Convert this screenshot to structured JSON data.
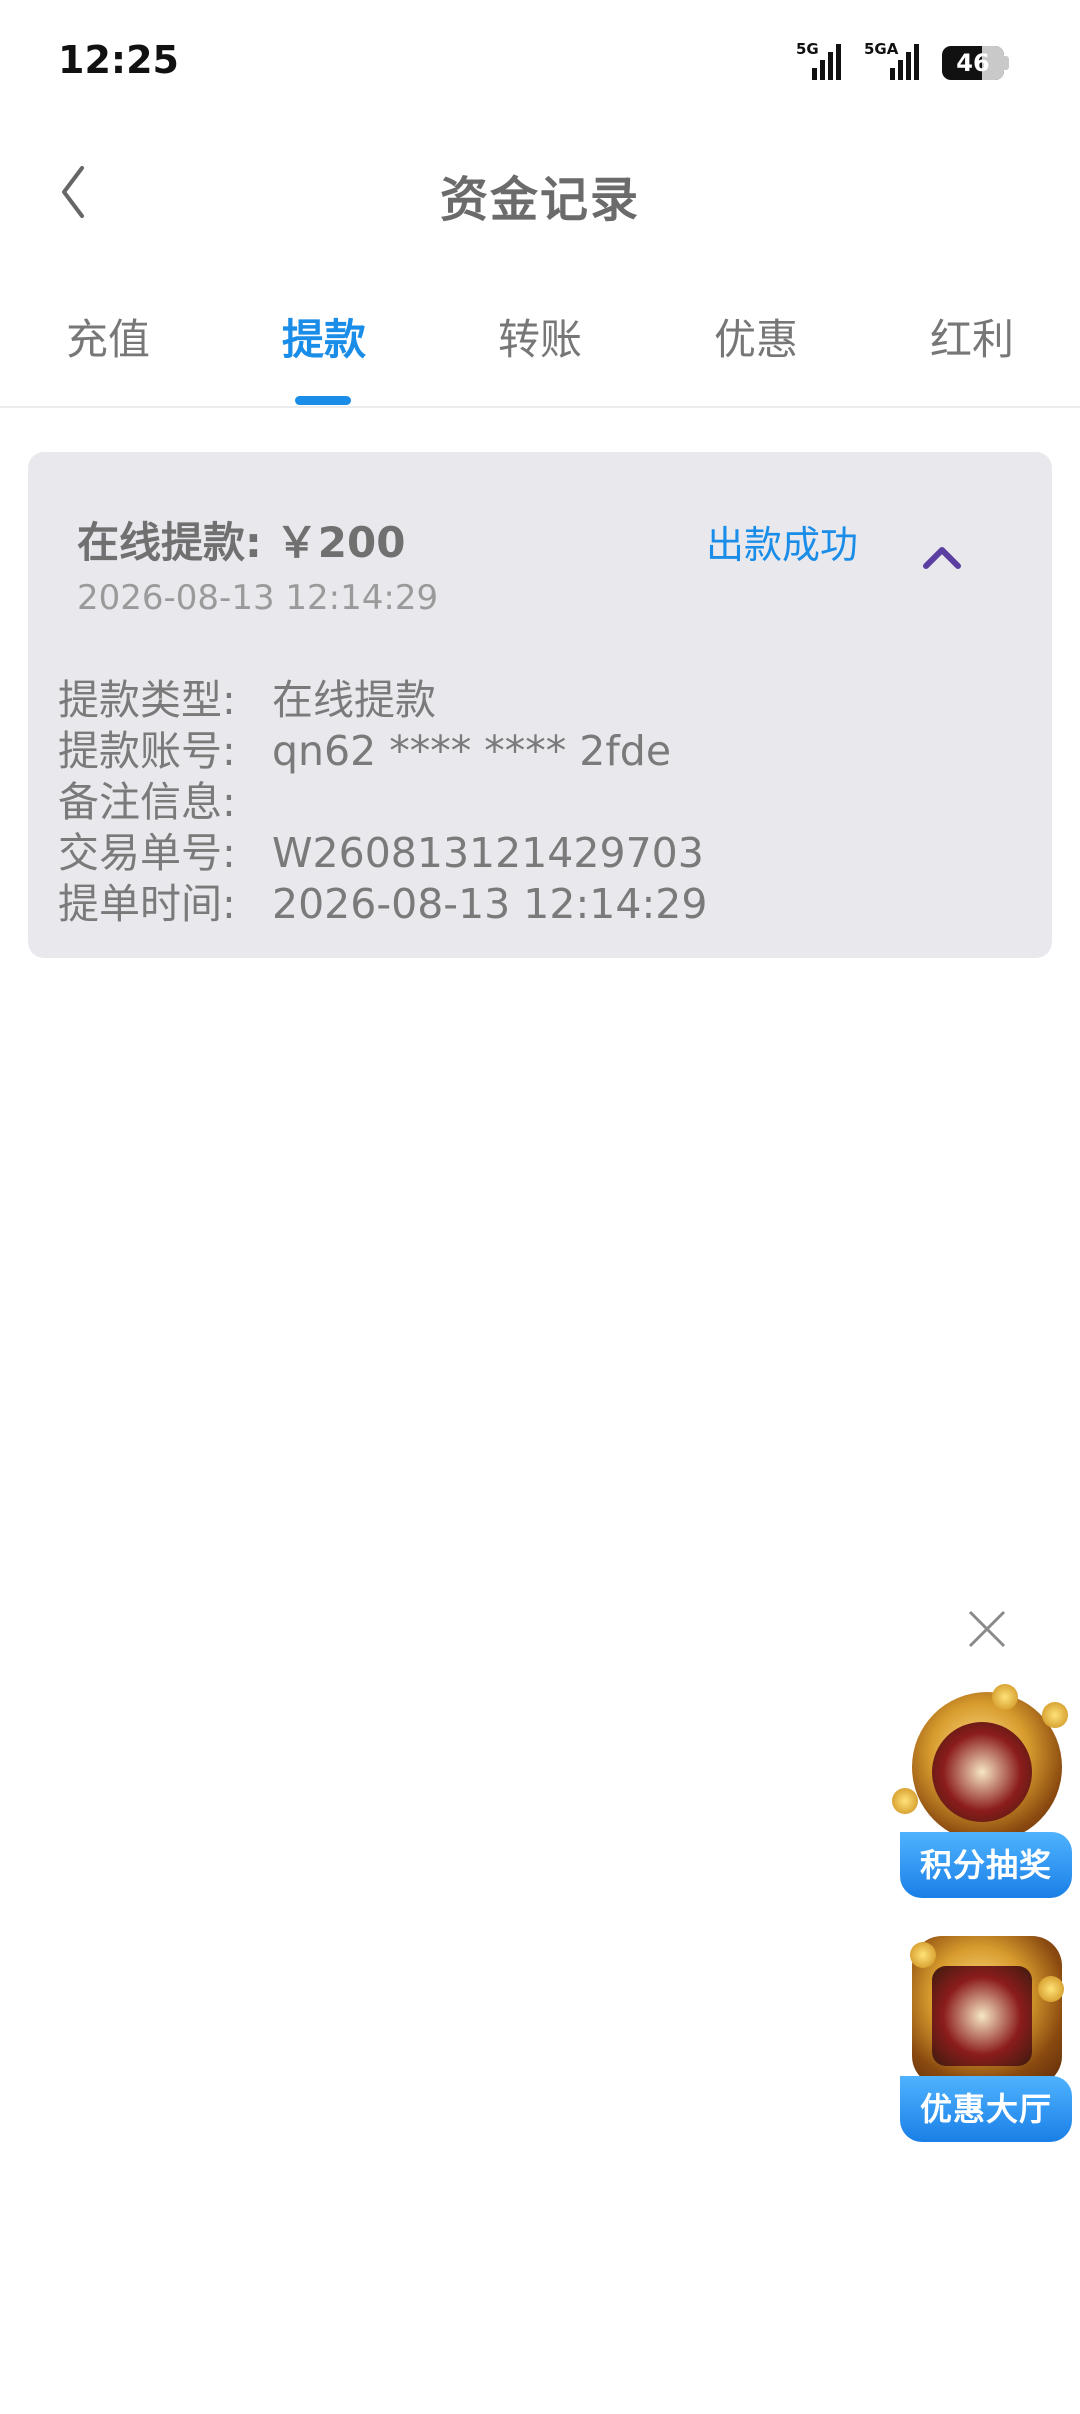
{
  "status_bar": {
    "time": "12:25",
    "sim1_label": "5G",
    "sim2_label": "5GA",
    "battery": "46"
  },
  "header": {
    "title": "资金记录"
  },
  "tabs": [
    {
      "label": "充值"
    },
    {
      "label": "提款"
    },
    {
      "label": "转账"
    },
    {
      "label": "优惠"
    },
    {
      "label": "红利"
    }
  ],
  "active_tab": "提款",
  "record": {
    "title_label": "在线提款:",
    "amount": "￥200",
    "status": "出款成功",
    "date": "2026-08-13 12:14:29",
    "details": [
      {
        "key": "提款类型:",
        "value": "在线提款"
      },
      {
        "key": "提款账号:",
        "value": "qn62 **** **** 2fde"
      },
      {
        "key": "备注信息:",
        "value": ""
      },
      {
        "key": "交易单号:",
        "value": "W260813121429703"
      },
      {
        "key": "提单时间:",
        "value": "2026-08-13 12:14:29"
      }
    ]
  },
  "floating": {
    "lottery_label": "积分抽奖",
    "promo_hall_label": "优惠大厅"
  },
  "colors": {
    "accent": "#1a8de9",
    "card_bg": "#e9e9ed",
    "chevron": "#5b3fa0"
  }
}
